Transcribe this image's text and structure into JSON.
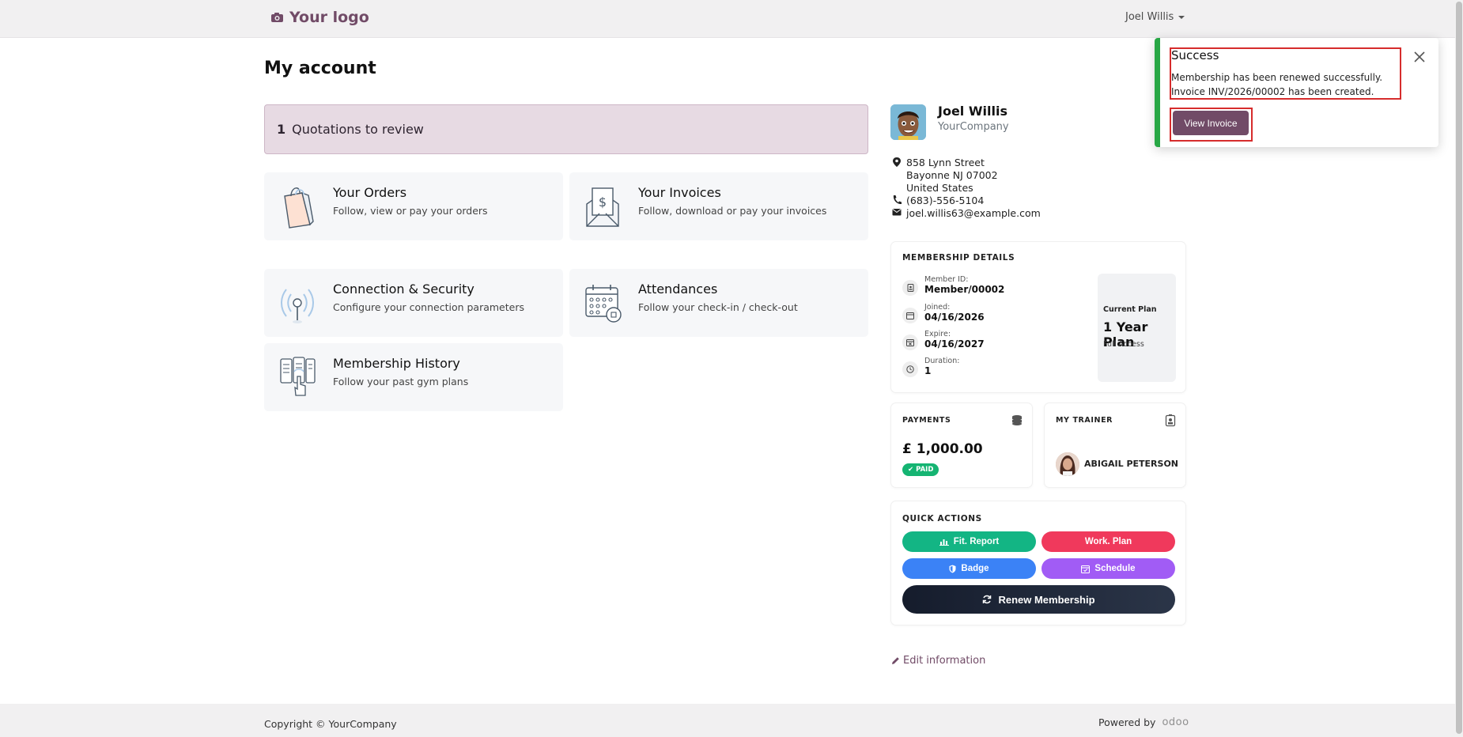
{
  "header": {
    "logo_text": "Your logo",
    "user_name": "Joel Willis"
  },
  "page": {
    "title": "My account"
  },
  "quotations": {
    "count": "1",
    "label": "Quotations to review"
  },
  "cards": [
    {
      "title": "Your Orders",
      "subtitle": "Follow, view or pay your orders",
      "icon": "shopping-bag-icon"
    },
    {
      "title": "Your Invoices",
      "subtitle": "Follow, download or pay your invoices",
      "icon": "invoice-envelope-icon"
    },
    {
      "title": "Connection & Security",
      "subtitle": "Configure your connection parameters",
      "icon": "antenna-icon"
    },
    {
      "title": "Attendances",
      "subtitle": "Follow your check-in / check-out",
      "icon": "calendar-icon"
    },
    {
      "title": "Membership History",
      "subtitle": "Follow your past gym plans",
      "icon": "membership-history-icon"
    }
  ],
  "profile": {
    "name": "Joel Willis",
    "company": "YourCompany",
    "address_line1": "858 Lynn Street",
    "address_line2": "Bayonne NJ 07002",
    "address_line3": "United States",
    "phone": "(683)-556-5104",
    "email": "joel.willis63@example.com"
  },
  "membership": {
    "title": "MEMBERSHIP DETAILS",
    "member_id_label": "Member ID:",
    "member_id": "Member/00002",
    "joined_label": "Joined:",
    "joined": "04/16/2026",
    "expire_label": "Expire:",
    "expire": "04/16/2027",
    "duration_label": "Duration:",
    "duration": "1",
    "plan_label": "Current Plan",
    "plan_name": "1 Year Plan",
    "plan_access": "Full Access"
  },
  "payments": {
    "title": "PAYMENTS",
    "amount": "£ 1,000.00",
    "status": "PAID"
  },
  "trainer": {
    "title": "MY TRAINER",
    "name": "ABIGAIL PETERSON"
  },
  "quick_actions": {
    "title": "QUICK ACTIONS",
    "fit_report": "Fit. Report",
    "work_plan": "Work. Plan",
    "badge": "Badge",
    "schedule": "Schedule",
    "renew": "Renew Membership"
  },
  "edit_info": "Edit information",
  "footer": {
    "copyright": "Copyright © YourCompany",
    "powered_by": "Powered by",
    "brand": "odoo"
  },
  "toast": {
    "title": "Success",
    "message_line1": "Membership has been renewed successfully.",
    "message_line2": "Invoice INV/2026/00002 has been created.",
    "button": "View Invoice"
  },
  "colors": {
    "brand": "#714b67",
    "success": "#28a745",
    "fit_report": "#13b584",
    "work_plan": "#f0395c",
    "badge": "#3b82f6",
    "schedule": "#a15cf5",
    "highlight": "#d62c2c"
  }
}
